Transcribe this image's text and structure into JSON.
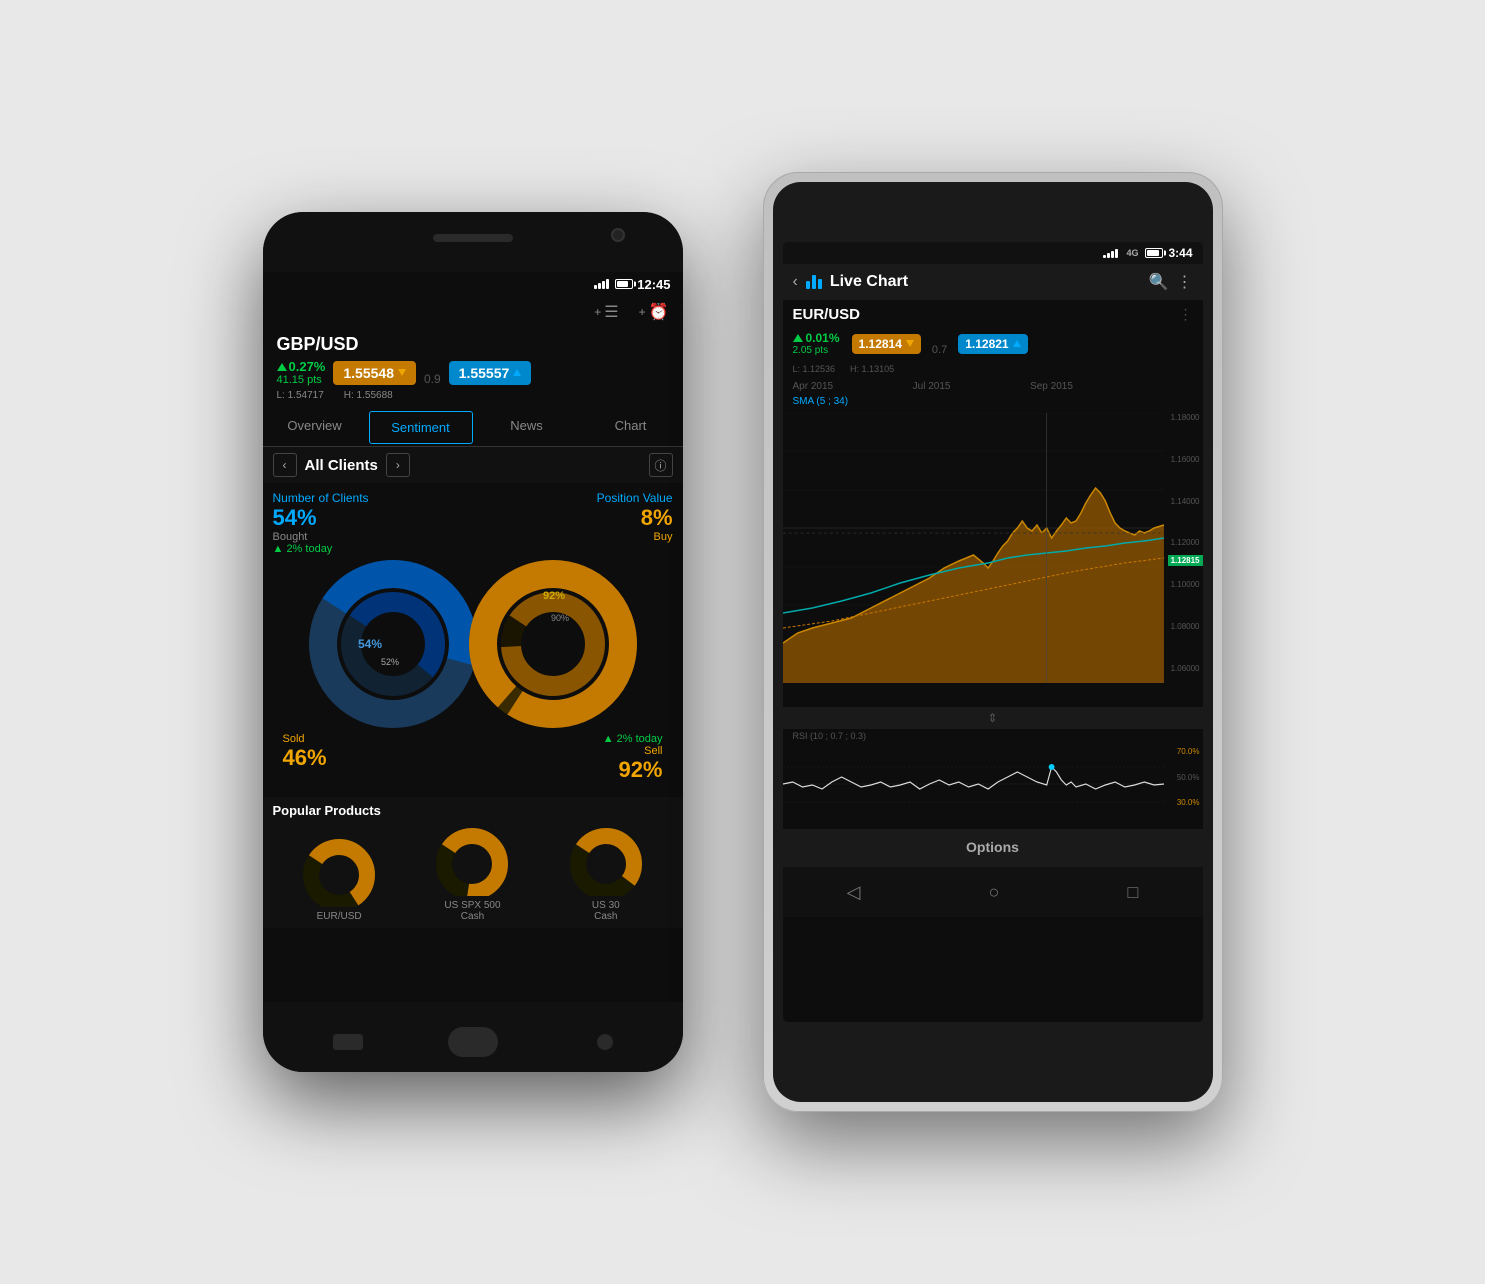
{
  "phone_left": {
    "status": {
      "time": "12:45"
    },
    "instrument": {
      "name": "GBP/USD",
      "change_pct": "0.27%",
      "change_pts": "41.15 pts",
      "sell_price": "1.55548",
      "buy_price": "1.55557",
      "low": "L: 1.54717",
      "high": "H: 1.55688",
      "spread": "0.9"
    },
    "tabs": [
      "Overview",
      "Sentiment",
      "News",
      "Chart"
    ],
    "active_tab": "Sentiment",
    "clients": {
      "title": "All Clients",
      "number_of_clients_label": "Number of Clients",
      "position_value_label": "Position Value",
      "bought_pct": "54%",
      "bought_label": "Bought",
      "sold_pct": "46%",
      "sold_label": "Sold",
      "buy_pct": "8%",
      "buy_label": "Buy",
      "sell_pct": "92%",
      "sell_label": "Sell",
      "today_change_clients": "▲ 2% today",
      "today_change_pos": "▲ 2% today",
      "inner_pct_left": "52%",
      "inner_pct_right": "90%",
      "outer_pct_left": "54%",
      "outer_pct_right": "92%"
    },
    "popular_products": {
      "title": "Popular Products",
      "items": [
        {
          "name": "EUR/USD"
        },
        {
          "name": "US SPX 500\nCash"
        },
        {
          "name": "US 30\nCash"
        }
      ]
    }
  },
  "phone_right": {
    "status": {
      "time": "3:44",
      "network": "4G"
    },
    "header": {
      "title": "Live Chart",
      "back_icon": "‹",
      "search_icon": "🔍",
      "more_icon": "⋮"
    },
    "instrument": {
      "name": "EUR/USD",
      "change_pct": "0.01%",
      "change_pts": "2.05 pts",
      "sell_price": "1.12814",
      "buy_price": "1.12821",
      "low": "L: 1.12536",
      "high": "H: 1.13105",
      "spread": "0.7",
      "current_price": "1.12815"
    },
    "chart": {
      "dates": [
        "Apr 2015",
        "Jul 2015",
        "Sep 2015"
      ],
      "sma_label": "SMA (5 ; 34)",
      "price_labels": [
        "1.18000",
        "1.16000",
        "1.14000",
        "1.12000",
        "1.10000",
        "1.08000",
        "1.06000"
      ],
      "rsi_label": "RSI (10 ; 0.7 ; 0.3)",
      "rsi_labels": [
        "70.0%",
        "50.0%",
        "30.0%"
      ]
    },
    "buttons": {
      "options": "Options"
    },
    "nav": {
      "back": "◁",
      "home": "○",
      "recent": "□"
    }
  }
}
